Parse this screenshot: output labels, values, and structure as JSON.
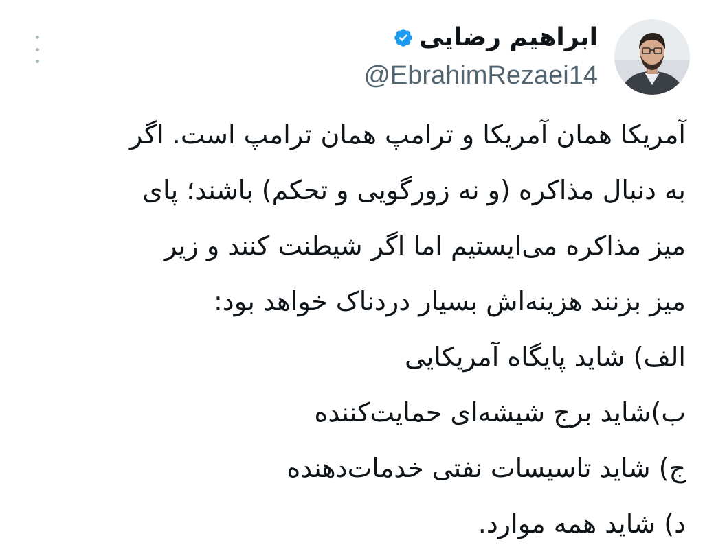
{
  "author": {
    "display_name": "ابراهیم رضایی",
    "handle": "@EbrahimRezaei14",
    "verified": true,
    "avatar_icon": "profile-photo",
    "verified_icon": "verified-badge-icon",
    "verified_color": "#1d9bf0"
  },
  "more_menu": {
    "icon": "more-vertical-icon"
  },
  "tweet": {
    "lines": [
      "آمریکا همان آمریکا و ترامپ همان ترامپ است. اگر",
      "به دنبال مذاکره (و نه زورگویی و تحکم) باشند؛ پای",
      "میز مذاکره می‌ایستیم اما اگر شیطنت کنند و زیر",
      "میز بزنند هزینه‌اش بسیار دردناک خواهد بود:",
      "الف) شاید پایگاه آمریکایی",
      "ب)شاید برج شیشه‌ای حمایت‌کننده",
      "ج) شاید تاسیسات نفتی خدمات‌دهنده",
      "د) شاید همه موارد."
    ]
  }
}
